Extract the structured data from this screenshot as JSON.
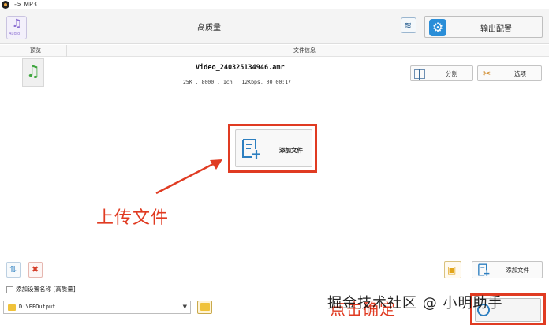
{
  "window": {
    "title": "-> MP3"
  },
  "toolbar": {
    "audio_icon_caption": "Audio",
    "quality_label": "高质量",
    "output_config_label": "输出配置"
  },
  "list": {
    "headers": {
      "preview": "预览",
      "file_info": "文件信息"
    },
    "rows": [
      {
        "file_name": "Video_240325134946.amr",
        "meta": "25K , 8000 , 1ch , 12Kbps, 00:00:17",
        "split_label": "分割",
        "options_label": "选项"
      }
    ]
  },
  "center": {
    "add_file_label": "添加文件"
  },
  "annotations": {
    "upload_text": "上传文件",
    "confirm_text": "点击确定",
    "watermark": "掘金技术社区 @ 小明助手",
    "highlight_color": "#e03b22"
  },
  "bottom": {
    "add_file_label": "添加文件",
    "setting_name_label": "添加设置名称 [高质量]",
    "output_path": "D:\\FFOutput"
  }
}
